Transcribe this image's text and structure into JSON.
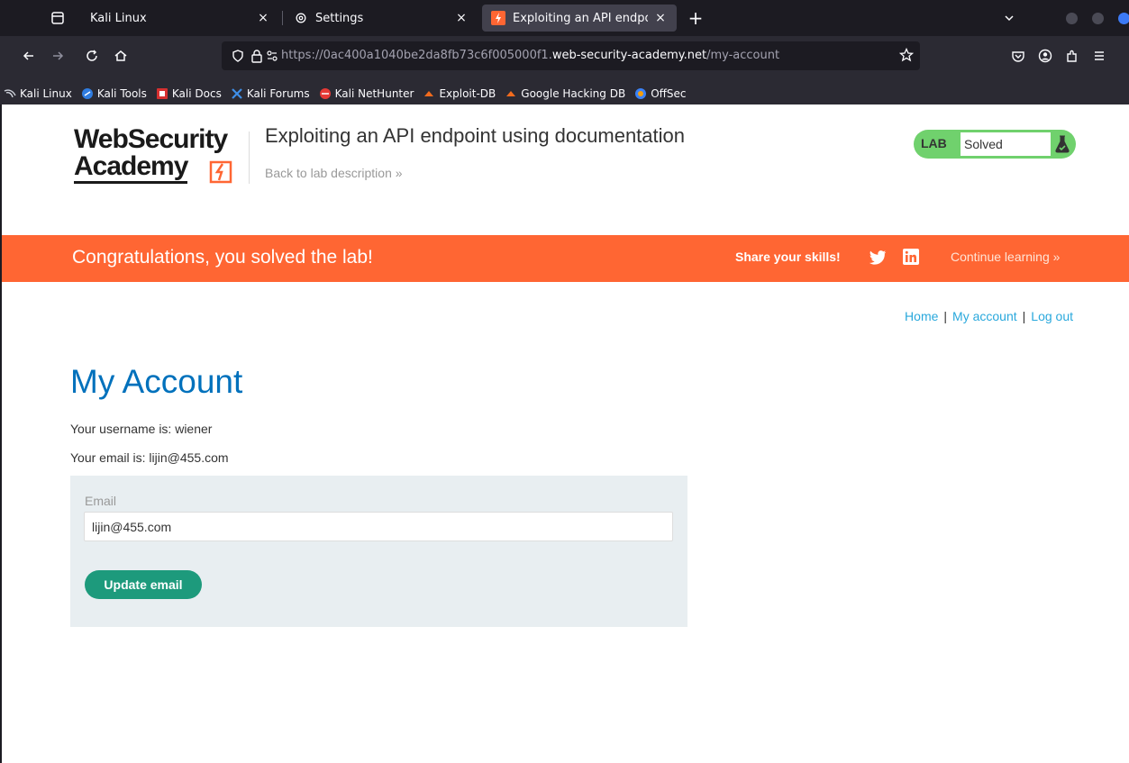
{
  "browser": {
    "tabs": [
      {
        "title": "Kali Linux",
        "active": false
      },
      {
        "title": "Settings",
        "active": false
      },
      {
        "title": "Exploiting an API endpoin",
        "active": true
      }
    ],
    "url": {
      "prefix": "https://0ac400a1040be2da8fb73c6f005000f1.",
      "host": "web-security-academy.net",
      "path": "/my-account"
    },
    "bookmarks": [
      {
        "label": "Kali Linux",
        "icon": "kali-dragon-icon"
      },
      {
        "label": "Kali Tools",
        "icon": "kali-tools-icon"
      },
      {
        "label": "Kali Docs",
        "icon": "kali-docs-icon"
      },
      {
        "label": "Kali Forums",
        "icon": "kali-forums-icon"
      },
      {
        "label": "Kali NetHunter",
        "icon": "nethunter-icon"
      },
      {
        "label": "Exploit-DB",
        "icon": "exploit-db-icon"
      },
      {
        "label": "Google Hacking DB",
        "icon": "ghdb-icon"
      },
      {
        "label": "OffSec",
        "icon": "offsec-icon"
      }
    ]
  },
  "header": {
    "logo_line1": "WebSecurity",
    "logo_line2": "Academy",
    "lab_title": "Exploiting an API endpoint using documentation",
    "back_link": "Back to lab description »",
    "lab_label": "LAB",
    "lab_state": "Solved"
  },
  "banner": {
    "message": "Congratulations, you solved the lab!",
    "share": "Share your skills!",
    "continue": "Continue learning »"
  },
  "nav": {
    "home": "Home",
    "sep": "|",
    "my_account": "My account",
    "logout": "Log out"
  },
  "main": {
    "title": "My Account",
    "username_line": "Your username is: wiener",
    "email_line": "Your email is: lijin@455.com",
    "form": {
      "label": "Email",
      "value": "lijin@455.com",
      "button": "Update email"
    }
  },
  "colors": {
    "banner": "#ff6633",
    "title_blue": "#0071bc",
    "link_blue": "#29a8dc",
    "button_green": "#1d9a7c",
    "lab_badge": "#70d16d"
  }
}
